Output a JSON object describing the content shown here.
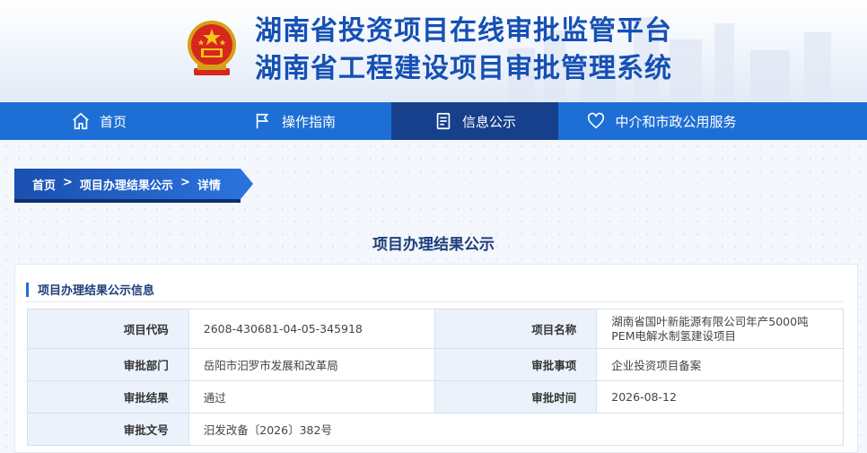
{
  "header": {
    "title_line1": "湖南省投资项目在线审批监管平台",
    "title_line2": "湖南省工程建设项目审批管理系统",
    "emblem_icon": "national-emblem"
  },
  "nav": {
    "items": [
      {
        "label": "首页",
        "icon": "home-icon"
      },
      {
        "label": "操作指南",
        "icon": "flag-icon"
      },
      {
        "label": "信息公示",
        "icon": "document-icon"
      },
      {
        "label": "中介和市政公用服务",
        "icon": "heart-icon"
      }
    ],
    "active_index": 2,
    "colors": {
      "bar": "#1d6fd6",
      "active": "#163f8c"
    }
  },
  "breadcrumb": {
    "items": [
      "首页",
      "项目办理结果公示",
      "详情"
    ],
    "separator": ">"
  },
  "page_title": "项目办理结果公示",
  "card": {
    "header": "项目办理结果公示信息",
    "rows": [
      {
        "l1": "项目代码",
        "v1": "2608-430681-04-05-345918",
        "l2": "项目名称",
        "v2": "湖南省国叶新能源有限公司年产5000吨PEM电解水制氢建设项目"
      },
      {
        "l1": "审批部门",
        "v1": "岳阳市汨罗市发展和改革局",
        "l2": "审批事项",
        "v2": "企业投资项目备案"
      },
      {
        "l1": "审批结果",
        "v1": "通过",
        "l2": "审批时间",
        "v2": "2026-08-12"
      },
      {
        "l1": "审批文号",
        "v1": "汨发改备〔2026〕382号"
      }
    ]
  }
}
